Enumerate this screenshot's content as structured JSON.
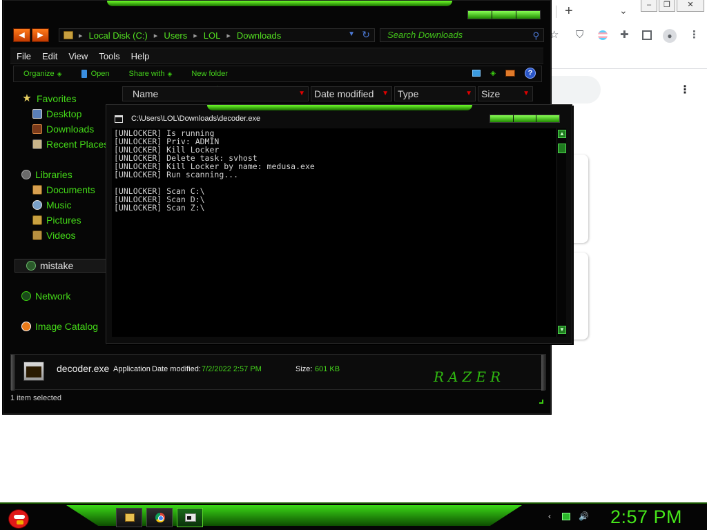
{
  "chrome": {
    "new_tab_glyph": "+",
    "tab_search_glyph": "⌄",
    "window_buttons": [
      "–",
      "❐",
      "✕"
    ],
    "toolbar_icons": [
      "star-icon",
      "ublock-icon",
      "pride-flag-icon",
      "extensions-icon",
      "side-panel-icon",
      "profile-icon",
      "kebab-menu-icon"
    ],
    "kebab": "⋮"
  },
  "explorer": {
    "nav": {
      "back": "◀",
      "forward": "▶"
    },
    "address": {
      "crumbs": [
        "Local Disk (C:)",
        "Users",
        "LOL",
        "Downloads"
      ],
      "separator": "▸"
    },
    "search": {
      "placeholder": "Search Downloads"
    },
    "menu": [
      "File",
      "Edit",
      "View",
      "Tools",
      "Help"
    ],
    "commands": {
      "organize": "Organize",
      "open": "Open",
      "share_with": "Share with",
      "new_folder": "New folder"
    },
    "columns": [
      "Name",
      "Date modified",
      "Type",
      "Size"
    ],
    "sidebar": {
      "favorites": "Favorites",
      "desktop": "Desktop",
      "downloads": "Downloads",
      "recent_places": "Recent Places",
      "libraries": "Libraries",
      "documents": "Documents",
      "music": "Music",
      "pictures": "Pictures",
      "videos": "Videos",
      "mistake": "mistake",
      "network": "Network",
      "image_catalog": "Image Catalog"
    },
    "details": {
      "filename": "decoder.exe",
      "type": "Application",
      "date_label": "Date modified:",
      "date_value": "7/2/2022 2:57 PM",
      "size_label": "Size:",
      "size_value": "601 KB",
      "brand": "RAZER"
    },
    "status": "1 item selected"
  },
  "console": {
    "title": "C:\\Users\\LOL\\Downloads\\decoder.exe",
    "output": "[UNLOCKER] Is running\n[UNLOCKER] Priv: ADMIN\n[UNLOCKER] Kill Locker\n[UNLOCKER] Delete task: svhost\n[UNLOCKER] Kill Locker by name: medusa.exe\n[UNLOCKER] Run scanning...\n\n[UNLOCKER] Scan C:\\\n[UNLOCKER] Scan D:\\\n[UNLOCKER] Scan Z:\\"
  },
  "taskbar": {
    "clock": "2:57 PM",
    "tray": {
      "chevron": "‹",
      "volume": "🔊"
    }
  },
  "colors": {
    "accent_green": "#45d51c",
    "window_bg": "#060606",
    "console_bg": "#000000",
    "clock_green": "#46e61a"
  }
}
